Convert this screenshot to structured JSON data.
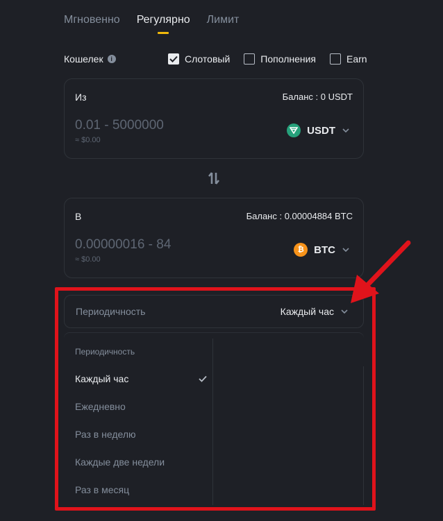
{
  "tabs": [
    {
      "label": "Мгновенно"
    },
    {
      "label": "Регулярно"
    },
    {
      "label": "Лимит"
    }
  ],
  "wallet": {
    "label": "Кошелек",
    "options": [
      {
        "label": "Слотовый",
        "checked": true
      },
      {
        "label": "Пополнения",
        "checked": false
      },
      {
        "label": "Earn",
        "checked": false
      }
    ]
  },
  "from": {
    "label": "Из",
    "balance": "Баланс : 0 USDT",
    "placeholder": "0.01 - 5000000",
    "approx": "≈ $0.00",
    "coin": "USDT",
    "coin_color": "#26a17b"
  },
  "to": {
    "label": "В",
    "balance": "Баланс : 0.00004884 BTC",
    "placeholder": "0.00000016 - 84",
    "approx": "≈ $0.00",
    "coin": "BTC",
    "coin_color": "#f7931a"
  },
  "frequency": {
    "label": "Периодичность",
    "value": "Каждый час"
  },
  "dropdown": {
    "header": "Периодичность",
    "options": [
      {
        "label": "Каждый час",
        "selected": true
      },
      {
        "label": "Ежедневно",
        "selected": false
      },
      {
        "label": "Раз в неделю",
        "selected": false
      },
      {
        "label": "Каждые две недели",
        "selected": false
      },
      {
        "label": "Раз в месяц",
        "selected": false
      }
    ]
  },
  "colors": {
    "background": "#1e2026",
    "accent": "#f0b90b",
    "annotation": "#e0131b"
  }
}
